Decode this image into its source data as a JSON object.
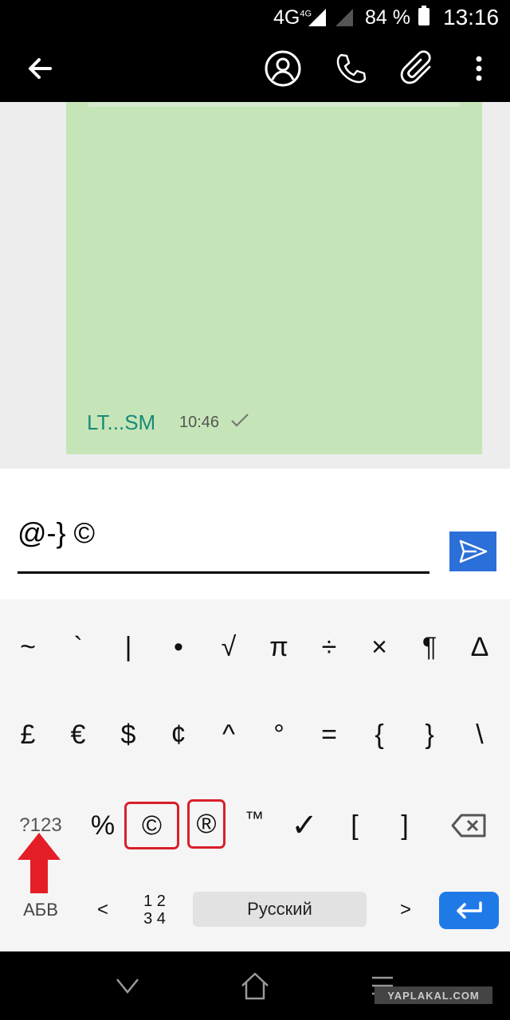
{
  "status_bar": {
    "network": "4G",
    "network_small": "4G",
    "battery_percent": "84 %",
    "time": "13:16"
  },
  "app_bar": {
    "icons": [
      "back-arrow-icon",
      "contact-icon",
      "phone-icon",
      "paperclip-icon",
      "more-vert-icon"
    ]
  },
  "message": {
    "sender": "LT...SM",
    "time": "10:46",
    "status_icon": "check-icon",
    "bubble_color": "#c5e5b8"
  },
  "composer": {
    "text": "@-} ©",
    "send_icon": "send-icon",
    "send_color": "#2b6fd8"
  },
  "keyboard": {
    "row1": [
      "~",
      "`",
      "|",
      "•",
      "√",
      "π",
      "÷",
      "×",
      "¶",
      "∆"
    ],
    "row2": [
      "£",
      "€",
      "$",
      "¢",
      "^",
      "°",
      "=",
      "{",
      "}",
      "\\"
    ],
    "row3": {
      "symbols_toggle": "?123",
      "keys": [
        "%",
        "©",
        "®",
        "™",
        "✓",
        "[",
        "]"
      ],
      "backspace_icon": "backspace-icon"
    },
    "row4": {
      "alpha_toggle": "АБВ",
      "less_than": "<",
      "numpad_top": "1 2",
      "numpad_bottom": "3 4",
      "space_label": "Русский",
      "greater_than": ">",
      "enter_icon": "enter-icon"
    },
    "highlight_color": "#d8202a"
  },
  "nav_bar": {
    "icons": [
      "chevron-down-icon",
      "home-icon",
      "menu-icon"
    ]
  },
  "watermark": "YAPLAKAL.COM"
}
